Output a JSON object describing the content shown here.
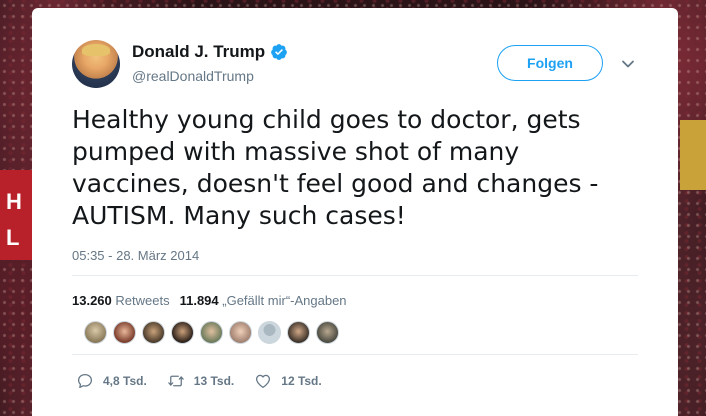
{
  "tweet": {
    "author_name": "Donald J. Trump",
    "handle": "@realDonaldTrump",
    "follow_label": "Folgen",
    "text": "Healthy young child goes to doctor, gets pumped with massive shot of many vaccines, doesn't feel good and changes - AUTISM. Many such cases!",
    "timestamp": "05:35 - 28. März 2014"
  },
  "stats": {
    "retweets_count": "13.260",
    "retweets_label": "Retweets",
    "likes_count": "11.894",
    "likes_label": "„Gefällt mir“-Angaben"
  },
  "actions": {
    "replies": "4,8 Tsd.",
    "retweets": "13 Tsd.",
    "likes": "12 Tsd."
  },
  "colors": {
    "accent": "#1da1f2",
    "secondary_text": "#657786",
    "primary_text": "#14171a"
  },
  "liker_avatars": [
    "avatar-1",
    "avatar-2",
    "avatar-3",
    "avatar-4",
    "avatar-5",
    "avatar-6",
    "avatar-7",
    "avatar-8",
    "avatar-9"
  ]
}
